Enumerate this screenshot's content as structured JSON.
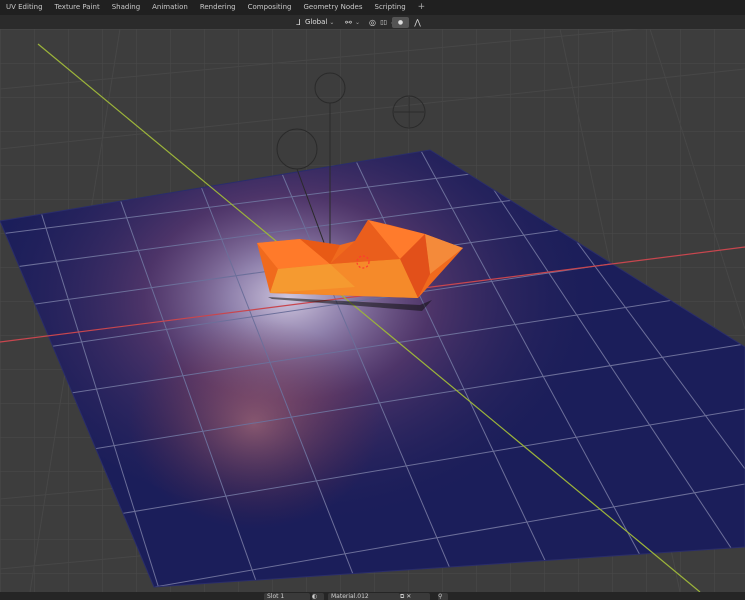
{
  "workspace_tabs": [
    "UV Editing",
    "Texture Paint",
    "Shading",
    "Animation",
    "Rendering",
    "Compositing",
    "Geometry Nodes",
    "Scripting",
    "+"
  ],
  "viewport_header": {
    "orientation_label": "Global",
    "pivot_icon": "pivot-point-icon",
    "snap_icon": "snap-icon",
    "proportional_icon": "proportional-edit-icon",
    "falloff_icon": "falloff-curve-icon"
  },
  "footer": {
    "slot_label": "Slot 1",
    "material_label": "Material.012"
  },
  "colors": {
    "grid_bg": "#3d3d3d",
    "plane": "#1a1d55",
    "x_axis": "#c8464e",
    "y_axis": "#9cb43a",
    "object": "#f06a1d"
  }
}
